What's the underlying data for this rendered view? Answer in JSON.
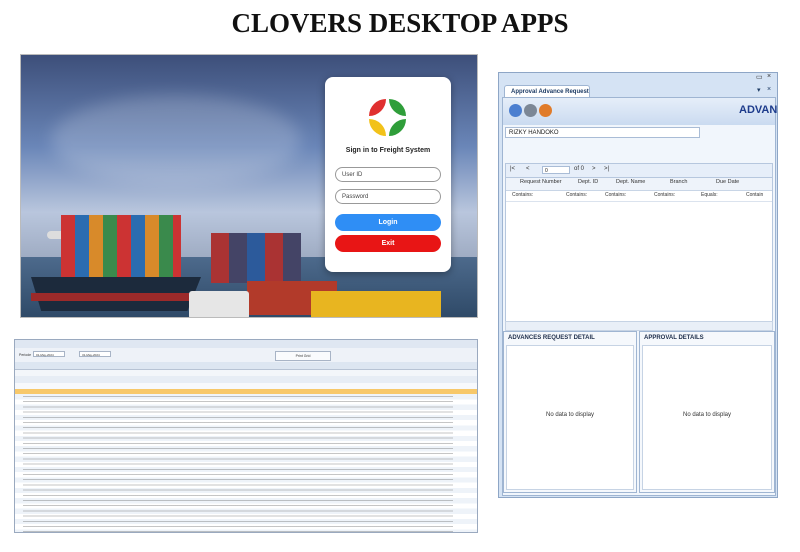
{
  "page": {
    "title": "CLOVERS DESKTOP APPS"
  },
  "login": {
    "heading": "Sign in to Freight System",
    "user_id_placeholder": "User ID",
    "password_placeholder": "Password",
    "login_label": "Login",
    "exit_label": "Exit",
    "colors": {
      "login": "#2f8ef5",
      "exit": "#e81515"
    }
  },
  "grid_screen": {
    "period_label": "Periode",
    "date_from": "01-May-2024",
    "date_to": "31-May-2024",
    "print_label": "Print Grid"
  },
  "approval": {
    "tab_title": "Approval Advance Request",
    "heading": "ADVANC",
    "requester": "RIZKY HANDOKO",
    "nav": {
      "first": "|<",
      "prev": "<",
      "page": "0",
      "of": "of 0",
      "next": ">",
      "last": ">|"
    },
    "columns": [
      "Request Number",
      "Dept. ID",
      "Dept. Name",
      "Branch",
      "Due Date"
    ],
    "filters": [
      "Contains:",
      "Contains:",
      "Contains:",
      "Contains:",
      "Equals:",
      "Contain"
    ],
    "sections": [
      {
        "title": "ADVANCES REQUEST DETAIL",
        "empty_text": "No data to display"
      },
      {
        "title": "APPROVAL DETAILS",
        "empty_text": "No data to display"
      }
    ]
  }
}
